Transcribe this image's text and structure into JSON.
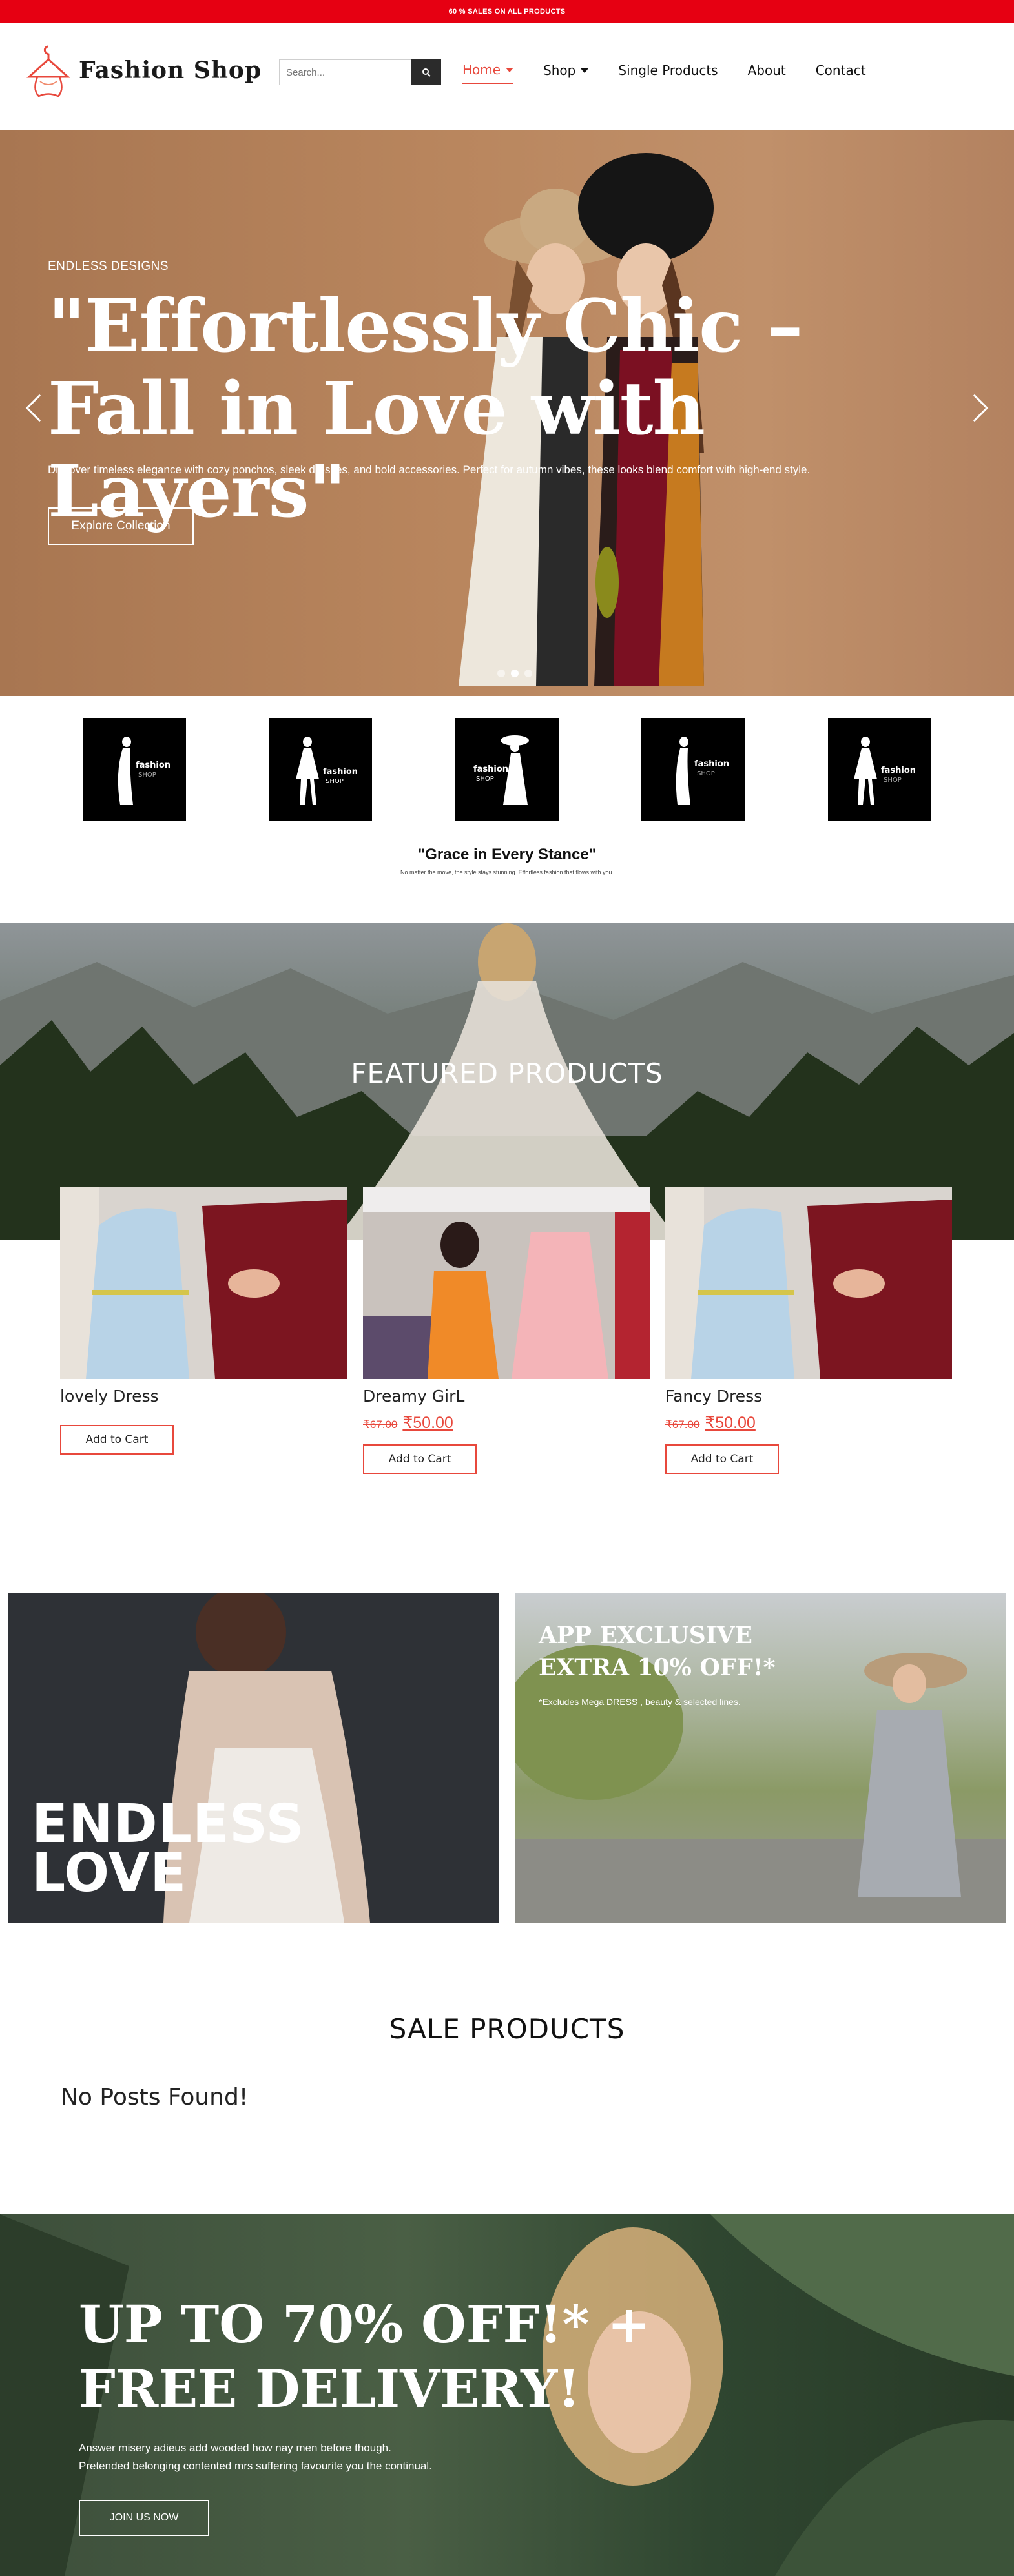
{
  "topbar": {
    "text": "60 % SALES ON ALL PRODUCTS"
  },
  "header": {
    "logo_text": "Fashion Shop",
    "search_placeholder": "Search...",
    "nav": [
      {
        "label": "Home",
        "active": true,
        "dropdown": true
      },
      {
        "label": "Shop",
        "active": false,
        "dropdown": true
      },
      {
        "label": "Single Products",
        "active": false,
        "dropdown": false
      },
      {
        "label": "About",
        "active": false,
        "dropdown": false
      },
      {
        "label": "Contact",
        "active": false,
        "dropdown": false
      }
    ]
  },
  "hero": {
    "subtitle": "ENDLESS DESIGNS",
    "title": "\"Effortlessly Chic – Fall in Love with Layers\"",
    "description": "Discover timeless elegance with cozy ponchos, sleek dresses, and bold accessories. Perfect for autumn vibes, these looks blend comfort with high-end style.",
    "button": "Explore Collection"
  },
  "brands": {
    "tiles": [
      "fashion SHOP",
      "fashion SHOP",
      "fashion SHOP",
      "fashion SHOP",
      "fashion SHOP"
    ]
  },
  "quote": {
    "title": "\"Grace in Every Stance\"",
    "subtitle": "No matter the move, the style stays stunning. Effortless fashion that flows with you."
  },
  "featured": {
    "title": "FEATURED PRODUCTS",
    "products": [
      {
        "name": "lovely Dress",
        "old_price": "",
        "price": "",
        "button": "Add to Cart"
      },
      {
        "name": "Dreamy GirL",
        "old_price": "₹67.00",
        "price": "₹50.00",
        "button": "Add to Cart"
      },
      {
        "name": "Fancy Dress",
        "old_price": "₹67.00",
        "price": "₹50.00",
        "button": "Add to Cart"
      }
    ]
  },
  "banners": {
    "left": {
      "title_line1": "ENDLESS",
      "title_line2": "LOVE"
    },
    "right": {
      "title_line1": "APP EXCLUSIVE",
      "title_line2": "EXTRA 10% OFF!*",
      "note": "*Excludes Mega DRESS , beauty & selected lines."
    }
  },
  "sale": {
    "title": "SALE PRODUCTS",
    "empty": "No Posts Found!"
  },
  "promo": {
    "title_line1": "UP TO 70% OFF!* +",
    "title_line2": "FREE DELIVERY!",
    "desc_line1": "Answer misery adieus add wooded how nay men before though.",
    "desc_line2": "Pretended belonging contented mrs suffering favourite you the continual.",
    "button": "JOIN US NOW"
  },
  "colors": {
    "accent": "#e8483c",
    "topbar": "#e60012"
  }
}
